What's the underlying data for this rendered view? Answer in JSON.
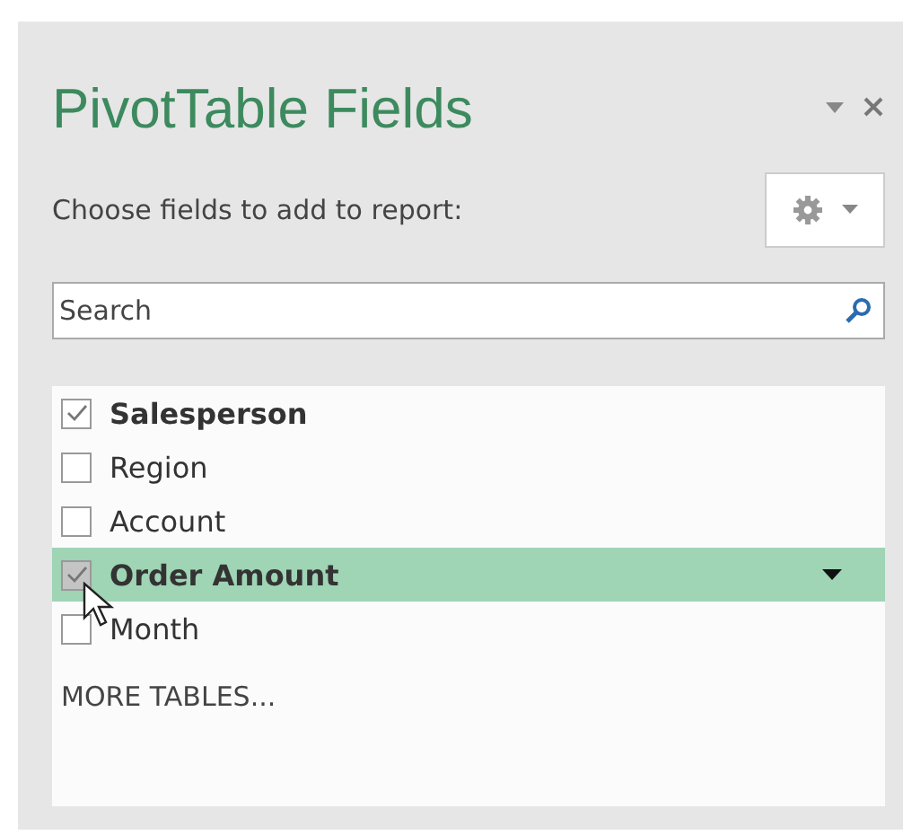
{
  "pane": {
    "title": "PivotTable Fields",
    "subtitle": "Choose fields to add to report:"
  },
  "search": {
    "placeholder": "Search"
  },
  "fields": [
    {
      "name": "Salesperson",
      "checked": true,
      "selected": false
    },
    {
      "name": "Region",
      "checked": false,
      "selected": false
    },
    {
      "name": "Account",
      "checked": false,
      "selected": false
    },
    {
      "name": "Order Amount",
      "checked": true,
      "selected": true
    },
    {
      "name": "Month",
      "checked": false,
      "selected": false
    }
  ],
  "more_tables": "MORE TABLES..."
}
